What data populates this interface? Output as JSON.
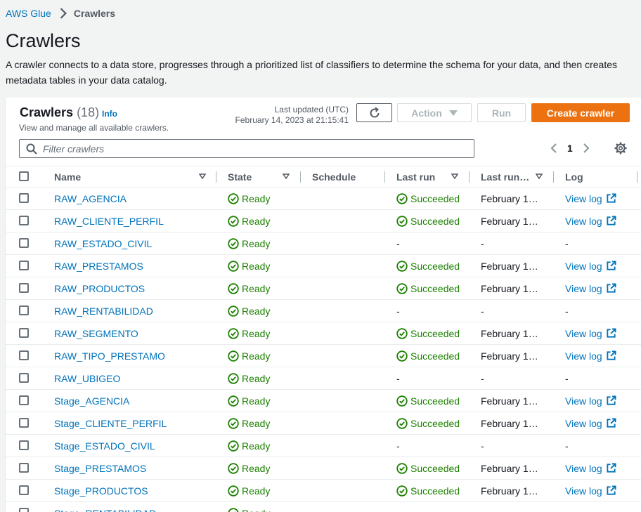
{
  "breadcrumb": {
    "root": "AWS Glue",
    "current": "Crawlers"
  },
  "page": {
    "title": "Crawlers",
    "description": "A crawler connects to a data store, progresses through a prioritized list of classifiers to determine the schema for your data, and then creates metadata tables in your data catalog."
  },
  "panel": {
    "title": "Crawlers",
    "count": "(18)",
    "info": "Info",
    "subtitle": "View and manage all available crawlers.",
    "last_updated_label": "Last updated (UTC)",
    "last_updated_value": "February 14, 2023 at 21:15:41",
    "action_label": "Action",
    "run_label": "Run",
    "create_label": "Create crawler",
    "search_placeholder": "Filter crawlers",
    "page_number": "1"
  },
  "columns": {
    "name": "Name",
    "state": "State",
    "schedule": "Schedule",
    "last_run": "Last run",
    "last_run_ts": "Last run…",
    "log": "Log"
  },
  "rows": [
    {
      "name": "RAW_AGENCIA",
      "state": "Ready",
      "last_run": "Succeeded",
      "timestamp": "February 1…",
      "log": "View log"
    },
    {
      "name": "RAW_CLIENTE_PERFIL",
      "state": "Ready",
      "last_run": "Succeeded",
      "timestamp": "February 1…",
      "log": "View log"
    },
    {
      "name": "RAW_ESTADO_CIVIL",
      "state": "Ready",
      "last_run": "-",
      "timestamp": "-",
      "log": "-"
    },
    {
      "name": "RAW_PRESTAMOS",
      "state": "Ready",
      "last_run": "Succeeded",
      "timestamp": "February 1…",
      "log": "View log"
    },
    {
      "name": "RAW_PRODUCTOS",
      "state": "Ready",
      "last_run": "Succeeded",
      "timestamp": "February 1…",
      "log": "View log"
    },
    {
      "name": "RAW_RENTABILIDAD",
      "state": "Ready",
      "last_run": "-",
      "timestamp": "-",
      "log": "-"
    },
    {
      "name": "RAW_SEGMENTO",
      "state": "Ready",
      "last_run": "Succeeded",
      "timestamp": "February 1…",
      "log": "View log"
    },
    {
      "name": "RAW_TIPO_PRESTAMO",
      "state": "Ready",
      "last_run": "Succeeded",
      "timestamp": "February 1…",
      "log": "View log"
    },
    {
      "name": "RAW_UBIGEO",
      "state": "Ready",
      "last_run": "-",
      "timestamp": "-",
      "log": "-"
    },
    {
      "name": "Stage_AGENCIA",
      "state": "Ready",
      "last_run": "Succeeded",
      "timestamp": "February 1…",
      "log": "View log"
    },
    {
      "name": "Stage_CLIENTE_PERFIL",
      "state": "Ready",
      "last_run": "Succeeded",
      "timestamp": "February 1…",
      "log": "View log"
    },
    {
      "name": "Stage_ESTADO_CIVIL",
      "state": "Ready",
      "last_run": "-",
      "timestamp": "-",
      "log": "-"
    },
    {
      "name": "Stage_PRESTAMOS",
      "state": "Ready",
      "last_run": "Succeeded",
      "timestamp": "February 1…",
      "log": "View log"
    },
    {
      "name": "Stage_PRODUCTOS",
      "state": "Ready",
      "last_run": "Succeeded",
      "timestamp": "February 1…",
      "log": "View log"
    },
    {
      "name": "Stage_RENTABILIDAD",
      "state": "Ready",
      "last_run": "",
      "timestamp": "",
      "log": ""
    }
  ],
  "colors": {
    "link": "#0073bb",
    "success": "#1d8102",
    "primary": "#ec7211",
    "background": "#f2f3f3"
  },
  "icons": {
    "breadcrumb_separator": "chevron-right-icon",
    "refresh": "refresh-icon",
    "search": "search-icon",
    "settings": "gear-icon",
    "status": "check-circle-icon",
    "external": "external-link-icon"
  }
}
